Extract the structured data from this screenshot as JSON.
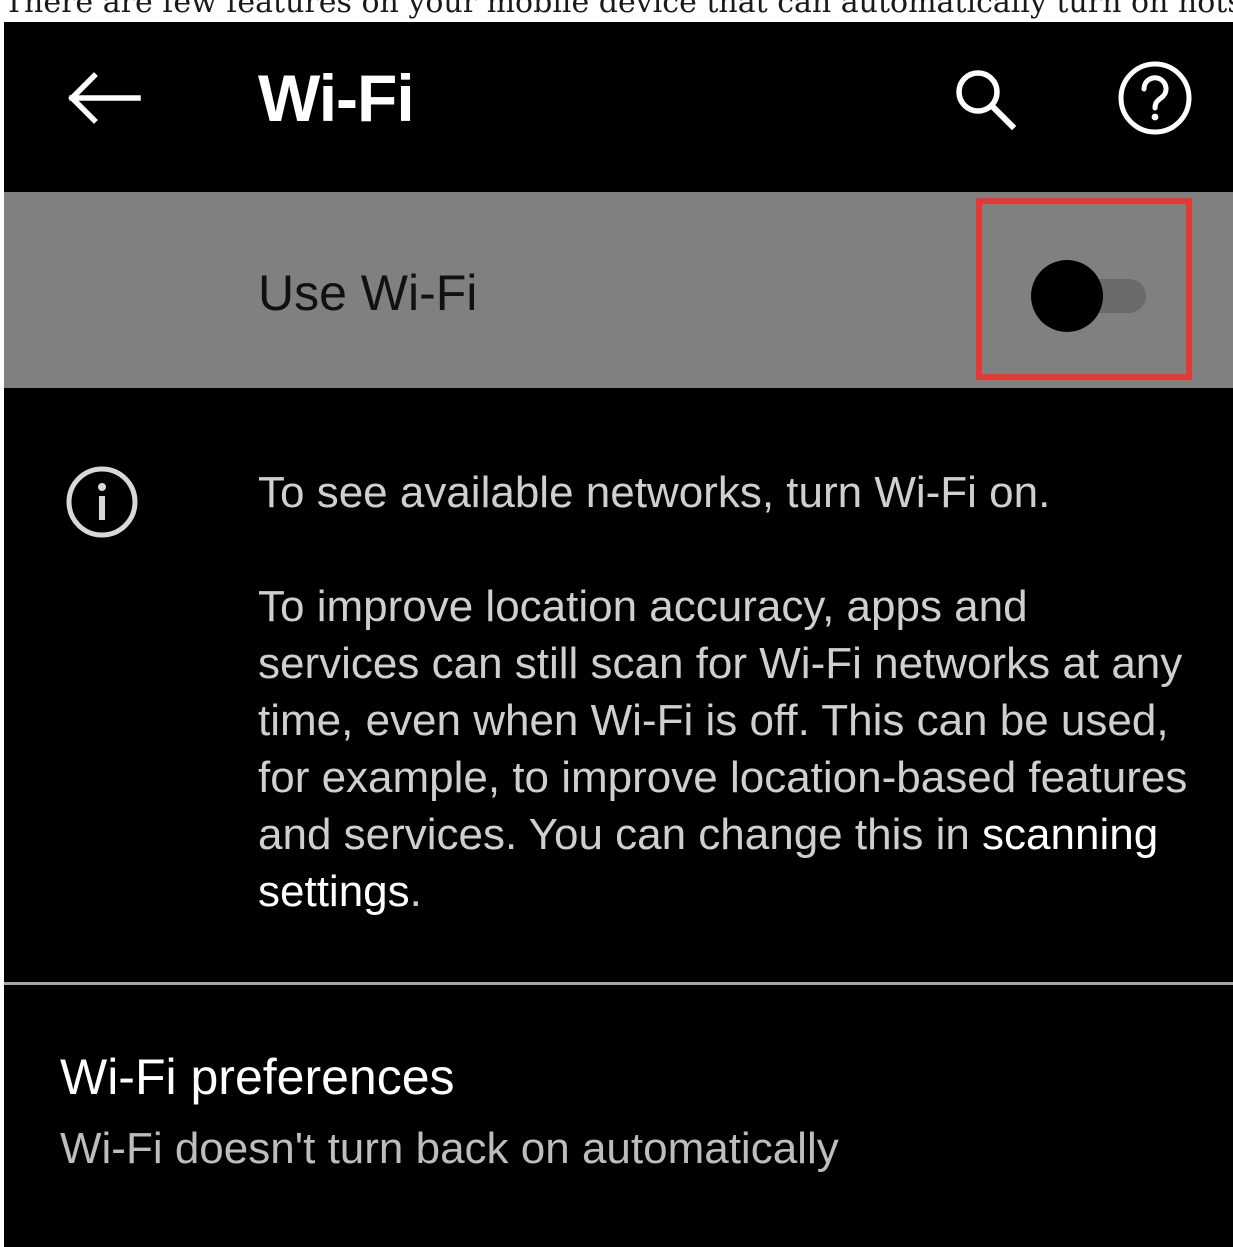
{
  "caption": {
    "text": "There are few features on your mobile device that can automatically turn on hotspots. Energy sav"
  },
  "app_bar": {
    "title": "Wi-Fi",
    "back_icon": "arrow-left-icon",
    "search_icon": "search-icon",
    "help_icon": "help-circle-icon"
  },
  "use_wifi": {
    "label": "Use Wi-Fi",
    "toggle_on": false,
    "highlight_color": "#e53935"
  },
  "info": {
    "icon": "info-icon",
    "paragraph_1": "To see available networks, turn Wi-Fi on.",
    "paragraph_2_text": "To improve location accuracy, apps and services can still scan for Wi-Fi networks at any time, even when Wi-Fi is off. This can be used, for example, to improve location-based features and services. You can change this in ",
    "paragraph_2_link": "scanning settings",
    "paragraph_2_end": "."
  },
  "preferences": {
    "title": "Wi-Fi preferences",
    "subtitle": "Wi-Fi doesn't turn back on automatically"
  },
  "colors": {
    "background": "#000000",
    "row_highlight": "#808080",
    "text_primary": "#ffffff",
    "text_secondary": "#cfcfcf"
  }
}
